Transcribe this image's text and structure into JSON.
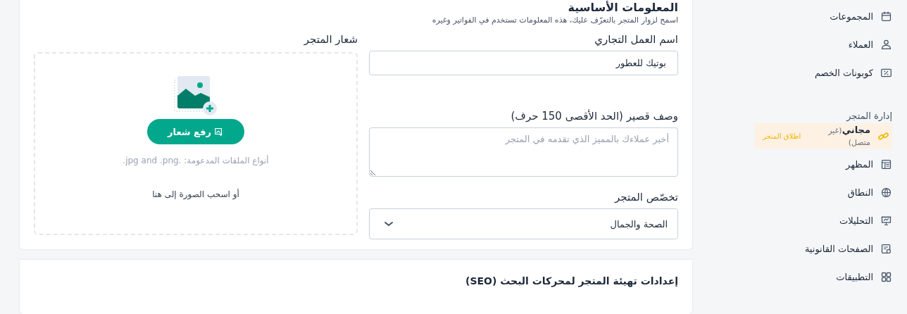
{
  "sidebar": {
    "items": [
      {
        "kind": "link",
        "label": "المجموعات"
      },
      {
        "kind": "link",
        "label": "العملاء"
      },
      {
        "kind": "link",
        "label": "كوبونات الخصم"
      },
      {
        "kind": "section",
        "label": "إدارة المتجر"
      },
      {
        "kind": "status",
        "label": "مجاني",
        "status": "(غير متصل)",
        "action": "اطلاق المتجر"
      },
      {
        "kind": "link",
        "label": "المظهر"
      },
      {
        "kind": "link",
        "label": "النطاق"
      },
      {
        "kind": "link",
        "label": "التحليلات"
      },
      {
        "kind": "link",
        "label": "الصفحات القانونية"
      },
      {
        "kind": "link",
        "label": "التطبيقات"
      }
    ]
  },
  "basic_info": {
    "title": "المعلومات الأساسية",
    "subtitle": "اسمح لزوار المتجر بالتعرّف عليك، هذه المعلومات تستخدم في الفواتير وغيره",
    "business_name": {
      "label": "اسم العمل التجاري",
      "value": "بوتيك للعطور"
    },
    "short_description": {
      "label": "وصف قصير (الحد الأقصى 150 حرف)",
      "placeholder": "أخبر عملاءك بالمميز الذي تقدمه في المتجر"
    },
    "specialty": {
      "label": "تخصّص المتجر",
      "value": "الصحة والجمال"
    },
    "logo": {
      "label": "شعار المتجر",
      "button": "رفع شعار",
      "file_types": "أنواع الملفات المدعومة: .jpg and .png.",
      "drag_hint": "أو اسحب الصورة إلى هنا"
    }
  },
  "seo": {
    "title": "إعدادات تهيئة المتجر لمحركات البحث (SEO)"
  }
}
